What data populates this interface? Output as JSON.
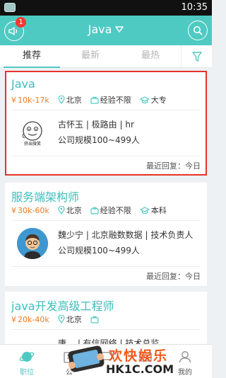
{
  "status_bar": {
    "time": "10:35"
  },
  "header": {
    "notification_count": "1",
    "title": "Java"
  },
  "tabs": [
    {
      "label": "推荐",
      "active": true
    },
    {
      "label": "最新",
      "active": false
    },
    {
      "label": "最热",
      "active": false
    }
  ],
  "jobs": [
    {
      "title": "Java",
      "salary": "10k-17k",
      "city": "北京",
      "experience": "经验不限",
      "education": "大专",
      "recruiter": "古怀玉 | 极路由 | hr",
      "company_size": "公司规模100~499人",
      "reply": "最近回复：今日",
      "avatar_caption": "挤出微笑",
      "selected": true
    },
    {
      "title": "服务端架构师",
      "salary": "30k-60k",
      "city": "北京",
      "experience": "经验不限",
      "education": "本科",
      "recruiter": "魏少宁 | 北京融数数据 | 技术负责人",
      "company_size": "公司规模100~499人",
      "reply": "最近回复：今日",
      "selected": false
    },
    {
      "title": "java开发高级工程师",
      "salary": "20k-40k",
      "city": "北京",
      "experience": "",
      "education": "",
      "recruiter": "唐… | 有信网络 | 技术总监",
      "selected": false
    }
  ],
  "bottom_nav": [
    {
      "label": "职位",
      "icon": "planet-icon"
    },
    {
      "label": "公",
      "icon": "company-icon"
    },
    {
      "label": "",
      "icon": "chat-icon"
    },
    {
      "label": "",
      "icon": "message-icon"
    },
    {
      "label": "我的",
      "icon": "profile-icon"
    }
  ],
  "watermark": {
    "line1": "欢快娱乐",
    "line2": "HK1C.COM"
  },
  "colors": {
    "accent": "#4fcac2",
    "salary": "#f07a20",
    "title": "#3bbfbd",
    "badge": "#f23b34",
    "selection": "#e5332a"
  }
}
